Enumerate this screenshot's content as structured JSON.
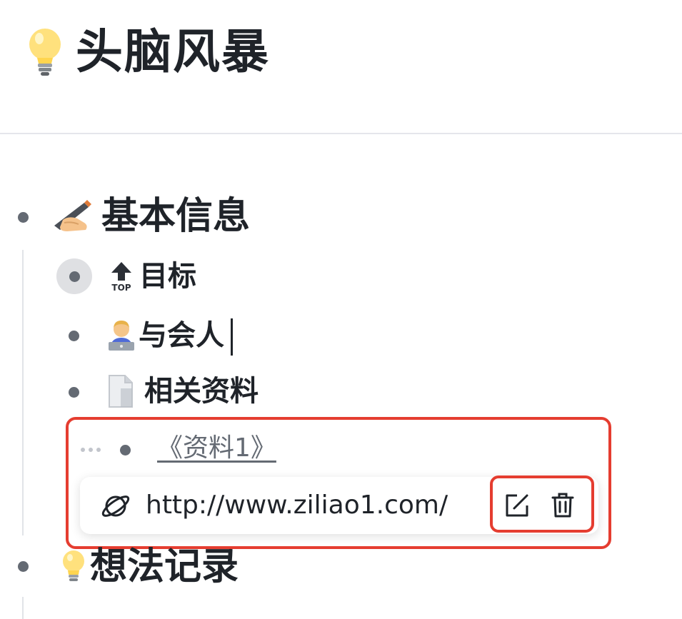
{
  "page": {
    "title": "头脑风暴",
    "title_icon": "lightbulb-icon"
  },
  "outline": {
    "basic_info": {
      "label": "基本信息",
      "icon": "writing-hand-icon"
    },
    "goal": {
      "label": "目标",
      "icon": "top-arrow-icon",
      "icon_text": "TOP"
    },
    "participants": {
      "label": "与会人",
      "icon": "technologist-icon"
    },
    "materials": {
      "label": "相关资料",
      "icon": "document-icon"
    },
    "material_link": {
      "label": "《资料1》"
    },
    "ideas": {
      "label": "想法记录",
      "icon": "lightbulb-icon"
    }
  },
  "link_popover": {
    "url": "http://www.ziliao1.com/",
    "link_icon": "planet-icon",
    "edit_icon": "edit-icon",
    "delete_icon": "trash-icon"
  },
  "colors": {
    "highlight_border": "#e53d30",
    "text": "#1f2329",
    "muted": "#646a73"
  }
}
